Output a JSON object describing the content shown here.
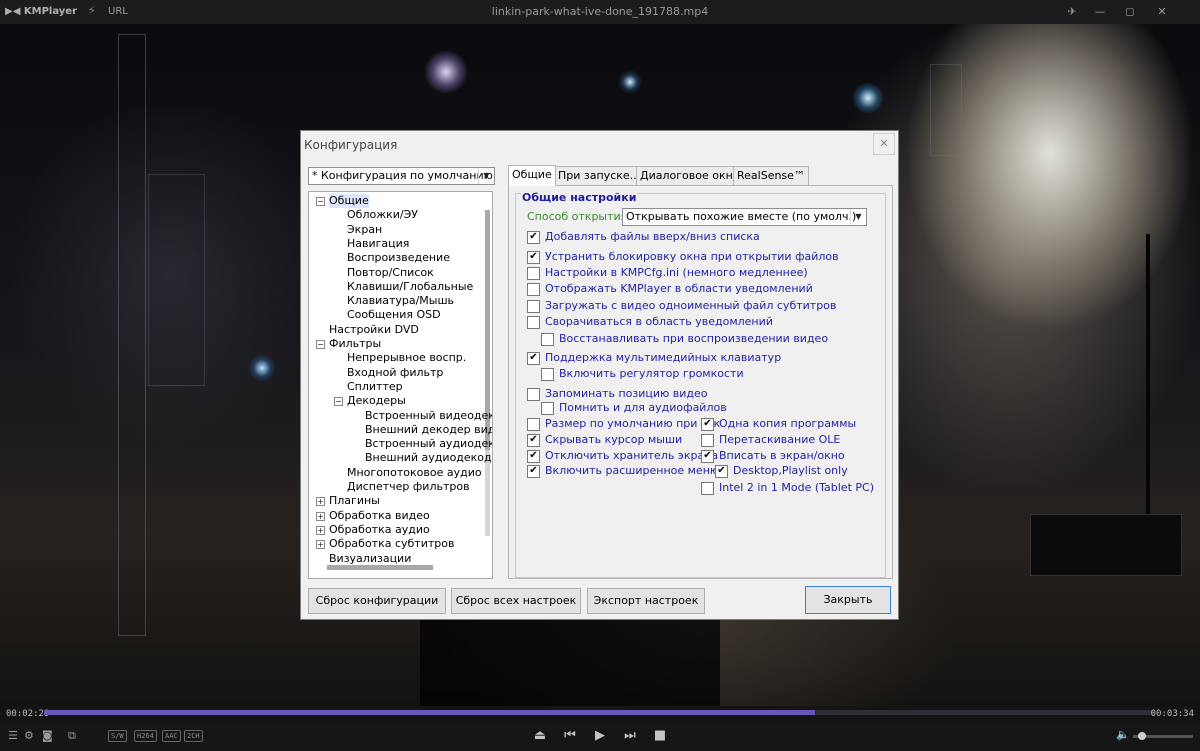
{
  "titlebar": {
    "app_name": "KMPlayer",
    "caret": "⌄",
    "bolt_icon": "lightning-icon",
    "url_label": "URL",
    "filename": "linkin-park-what-ive-done_191788.mp4",
    "pin_icon": "pin-icon",
    "minimize_icon": "minimize-icon",
    "maximize_icon": "maximize-icon",
    "close_icon": "close-icon"
  },
  "playback": {
    "current_time": "00:02:29",
    "total_time": "00:03:34",
    "progress_fraction": 0.695,
    "volume_fraction": 0.15,
    "badges": [
      "S/W",
      "H264",
      "AAC",
      "2CH"
    ],
    "accent_color": "#6a55b8"
  },
  "dialog": {
    "title": "Конфигурация",
    "close_glyph": "✕",
    "preset_value": "* Конфигурация по умолчанию",
    "tree": [
      {
        "label": "Общие",
        "level": 0,
        "expander": "−",
        "selected": true
      },
      {
        "label": "Обложки/ЭУ",
        "level": 1
      },
      {
        "label": "Экран",
        "level": 1
      },
      {
        "label": "Навигация",
        "level": 1
      },
      {
        "label": "Воспроизведение",
        "level": 1
      },
      {
        "label": "Повтор/Список",
        "level": 1
      },
      {
        "label": "Клавиши/Глобальные",
        "level": 1
      },
      {
        "label": "Клавиатура/Мышь",
        "level": 1
      },
      {
        "label": "Сообщения OSD",
        "level": 1
      },
      {
        "label": "Настройки DVD",
        "level": 0
      },
      {
        "label": "Фильтры",
        "level": 0,
        "expander": "−"
      },
      {
        "label": "Непрерывное воспр.",
        "level": 1
      },
      {
        "label": "Входной фильтр",
        "level": 1
      },
      {
        "label": "Сплиттер",
        "level": 1
      },
      {
        "label": "Декодеры",
        "level": 1,
        "expander": "−"
      },
      {
        "label": "Встроенный видеодек",
        "level": 2
      },
      {
        "label": "Внешний декодер вид",
        "level": 2
      },
      {
        "label": "Встроенный аудиодек",
        "level": 2
      },
      {
        "label": "Внешний аудиодекоде",
        "level": 2
      },
      {
        "label": "Многопотоковое аудио",
        "level": 1
      },
      {
        "label": "Диспетчер фильтров",
        "level": 1
      },
      {
        "label": "Плагины",
        "level": 0,
        "expander": "+"
      },
      {
        "label": "Обработка видео",
        "level": 0,
        "expander": "+"
      },
      {
        "label": "Обработка аудио",
        "level": 0,
        "expander": "+"
      },
      {
        "label": "Обработка субтитров",
        "level": 0,
        "expander": "+"
      },
      {
        "label": "Визуализации",
        "level": 0
      }
    ],
    "tabs": [
      "Общие",
      "При запуске...",
      "Диалоговое окно",
      "RealSense™"
    ],
    "active_tab": 0,
    "group_title": "Общие настройки",
    "open_mode_label": "Способ открытия:",
    "open_mode_value": "Открывать похожие вместе (по умолч.)",
    "options": [
      {
        "label": "Добавлять файлы вверх/вниз списка",
        "checked": true
      },
      {
        "label": "Устранить блокировку окна при открытии файлов",
        "checked": true
      },
      {
        "label": "Настройки в KMPCfg.ini (немного медленнее)",
        "checked": false
      },
      {
        "label": "Отображать KMPlayer в области уведомлений",
        "checked": false
      },
      {
        "label": "Загружать с видео одноименный файл субтитров",
        "checked": false
      },
      {
        "label": "Сворачиваться в область уведомлений",
        "checked": false
      },
      {
        "label": "Восстанавливать при воспроизведении видео",
        "checked": false
      },
      {
        "label": "Поддержка мультимедийных клавиатур",
        "checked": true
      },
      {
        "label": "Включить регулятор громкости",
        "checked": false
      },
      {
        "label": "Запоминать позицию видео",
        "checked": false
      },
      {
        "label": "Помнить и для аудиофайлов",
        "checked": false
      },
      {
        "label": "Размер по умолчанию при зак",
        "checked": false
      },
      {
        "label": "Скрывать курсор мыши",
        "checked": true
      },
      {
        "label": "Отключить хранитель экрана",
        "checked": true
      },
      {
        "label": "Включить расширенное меню",
        "checked": true
      },
      {
        "label": "Одна копия программы",
        "checked": true
      },
      {
        "label": "Перетаскивание OLE",
        "checked": false
      },
      {
        "label": "Вписать в экран/окно",
        "checked": true
      },
      {
        "label": "Desktop,Playlist only",
        "checked": true
      },
      {
        "label": "Intel 2 in 1 Mode (Tablet PC)",
        "checked": false
      }
    ],
    "check_glyph": "✔",
    "buttons": {
      "reset_config": "Сброс конфигурации",
      "reset_all": "Сброс всех настроек",
      "export": "Экспорт настроек",
      "close": "Закрыть"
    }
  }
}
